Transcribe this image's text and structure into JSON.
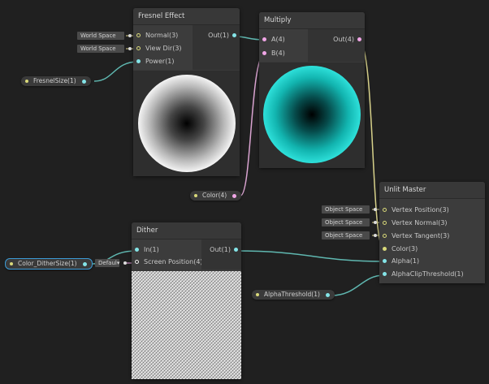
{
  "colors": {
    "vector": "#d9d97a",
    "float": "#84e4e7",
    "color4": "#f0a6e6",
    "wire_float": "#5fb7b0",
    "wire_color": "#d9a3d0",
    "wire_vector": "#d7d18a",
    "selection": "#3c9bd6"
  },
  "fresnel": {
    "title": "Fresnel Effect",
    "inputs": [
      "Normal(3)",
      "View Dir(3)",
      "Power(1)"
    ],
    "output": "Out(1)",
    "input_values": [
      "World Space",
      "World Space"
    ]
  },
  "multiply": {
    "title": "Multiply",
    "inputs": [
      "A(4)",
      "B(4)"
    ],
    "output": "Out(4)"
  },
  "dither": {
    "title": "Dither",
    "inputs": [
      "In(1)",
      "Screen Position(4)"
    ],
    "output": "Out(1)",
    "input_value": "Defaul▾"
  },
  "unlit": {
    "title": "Unlit Master",
    "inputs": [
      "Vertex Position(3)",
      "Vertex Normal(3)",
      "Vertex Tangent(3)",
      "Color(3)",
      "Alpha(1)",
      "AlphaClipThreshold(1)"
    ],
    "input_values": [
      "Object Space",
      "Object Space",
      "Object Space"
    ]
  },
  "properties": {
    "fresnel_size": "FresnelSize(1)",
    "color": "Color(4)",
    "color_dither_size": "Color_DitherSize(1)",
    "alpha_threshold": "AlphaThreshold(1)"
  }
}
